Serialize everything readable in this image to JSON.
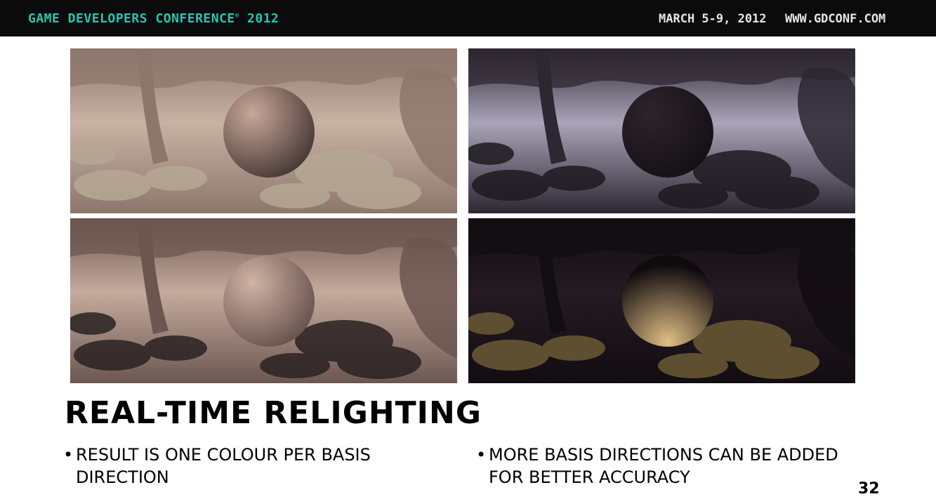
{
  "header": {
    "conference": "GAME DEVELOPERS CONFERENCE",
    "registered_mark": "®",
    "year": "2012",
    "dates": "MARCH 5-9, 2012",
    "url": "WWW.GDCONF.COM"
  },
  "panels": [
    {
      "id": "diffuse-bright",
      "ground": "#c8b2a4",
      "shade": "#8d776c",
      "sphere_light": "#c8a899",
      "sphere_dark": "#3a2d2c",
      "foliage": "#b6a895"
    },
    {
      "id": "dark-cool",
      "ground": "#a9a4b8",
      "shade": "#2d2732",
      "sphere_light": "#2c252c",
      "sphere_dark": "#120e12",
      "foliage": "#1e1a20"
    },
    {
      "id": "shadowed-warm",
      "ground": "#c5ab9d",
      "shade": "#6b5650",
      "sphere_light": "#d0b3a6",
      "sphere_dark": "#5c4944",
      "foliage": "#2a2222"
    },
    {
      "id": "dark-backlit",
      "ground": "#241a22",
      "shade": "#120d12",
      "sphere_light": "#e1bf85",
      "sphere_dark": "#0f0a0e",
      "foliage": "#6a5a35"
    }
  ],
  "slide": {
    "title": "REAL-TIME RELIGHTING",
    "bullet_char": "•",
    "bullets": [
      "RESULT IS ONE COLOUR PER BASIS DIRECTION",
      "MORE BASIS DIRECTIONS CAN BE ADDED FOR BETTER ACCURACY"
    ],
    "page_number": "32"
  }
}
